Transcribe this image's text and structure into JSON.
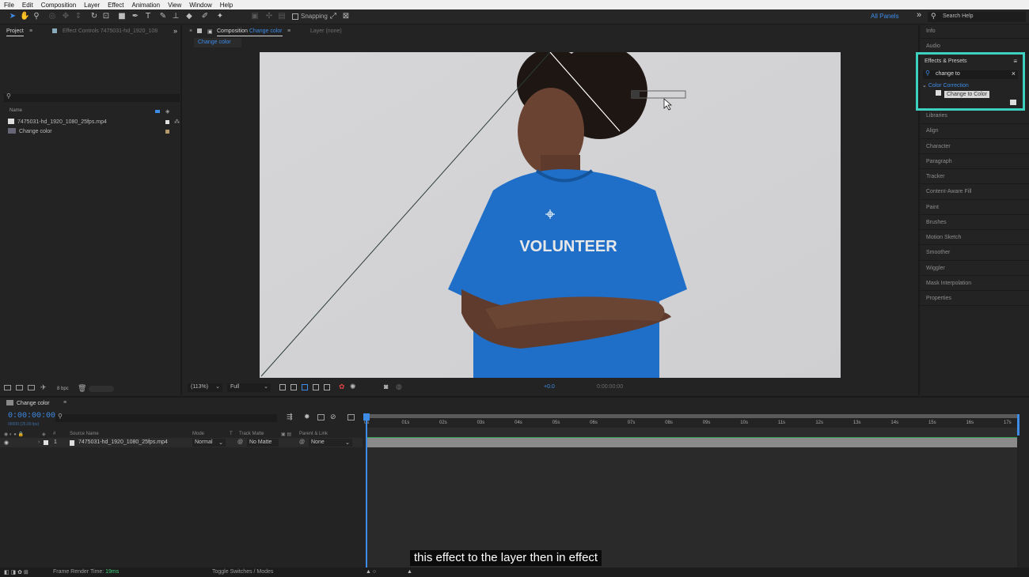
{
  "menu": [
    "File",
    "Edit",
    "Composition",
    "Layer",
    "Effect",
    "Animation",
    "View",
    "Window",
    "Help"
  ],
  "toolbar": {
    "snapping_label": "Snapping",
    "workspace_label": "All Panels",
    "search_help_placeholder": "Search Help"
  },
  "project_panel": {
    "tab_project": "Project",
    "tab_effect_controls": "Effect Controls 7475031-hd_1920_108",
    "column_name": "Name",
    "items": [
      {
        "name": "7475031-hd_1920_1080_25fps.mp4",
        "swatch": "#e0e0e0"
      },
      {
        "name": "Change color",
        "swatch": "#b59a6c"
      }
    ],
    "bpc_label": "8 bpc"
  },
  "composition_panel": {
    "tab_prefix": "Composition",
    "tab_comp_name": "Change color",
    "tab_layer": "Layer (none)",
    "subtab": "Change color",
    "zoom": "(113%)",
    "resolution": "Full",
    "exposure": "+0.0",
    "timecode": "0:00:00:00",
    "shirt_text": "VOLUNTEER"
  },
  "right_panel": {
    "items_top": [
      "Info",
      "Audio"
    ],
    "effects_presets": {
      "title": "Effects & Presets",
      "search_value": "change to",
      "category": "Color Correction",
      "result": "Change to Color"
    },
    "items_bottom": [
      "Libraries",
      "Align",
      "Character",
      "Paragraph",
      "Tracker",
      "Content-Aware Fill",
      "Paint",
      "Brushes",
      "Motion Sketch",
      "Smoother",
      "Wiggler",
      "Mask Interpolation",
      "Properties"
    ]
  },
  "timeline": {
    "tab": "Change color",
    "timecode": "0:00:00:00",
    "timecode_sub": "00000 (25.00 fps)",
    "columns": {
      "source_name": "Source Name",
      "mode": "Mode",
      "t": "T",
      "track_matte": "Track Matte",
      "parent": "Parent & Link"
    },
    "layer": {
      "index": "1",
      "name": "7475031-hd_1920_1080_25fps.mp4",
      "mode": "Normal",
      "matte": "No Matte",
      "parent": "None"
    },
    "ticks": [
      "0s",
      "01s",
      "02s",
      "03s",
      "04s",
      "05s",
      "06s",
      "07s",
      "08s",
      "09s",
      "10s",
      "11s",
      "12s",
      "13s",
      "14s",
      "15s",
      "16s",
      "17s"
    ]
  },
  "status_bar": {
    "render_label": "Frame Render Time:",
    "render_value": "19ms",
    "toggle_label": "Toggle Switches / Modes"
  },
  "caption": "this effect to the layer then in effect",
  "colors": {
    "accent_blue": "#3d8ce8",
    "highlight_teal": "#3dd0c0",
    "shirt_blue": "#1f6fc9"
  }
}
